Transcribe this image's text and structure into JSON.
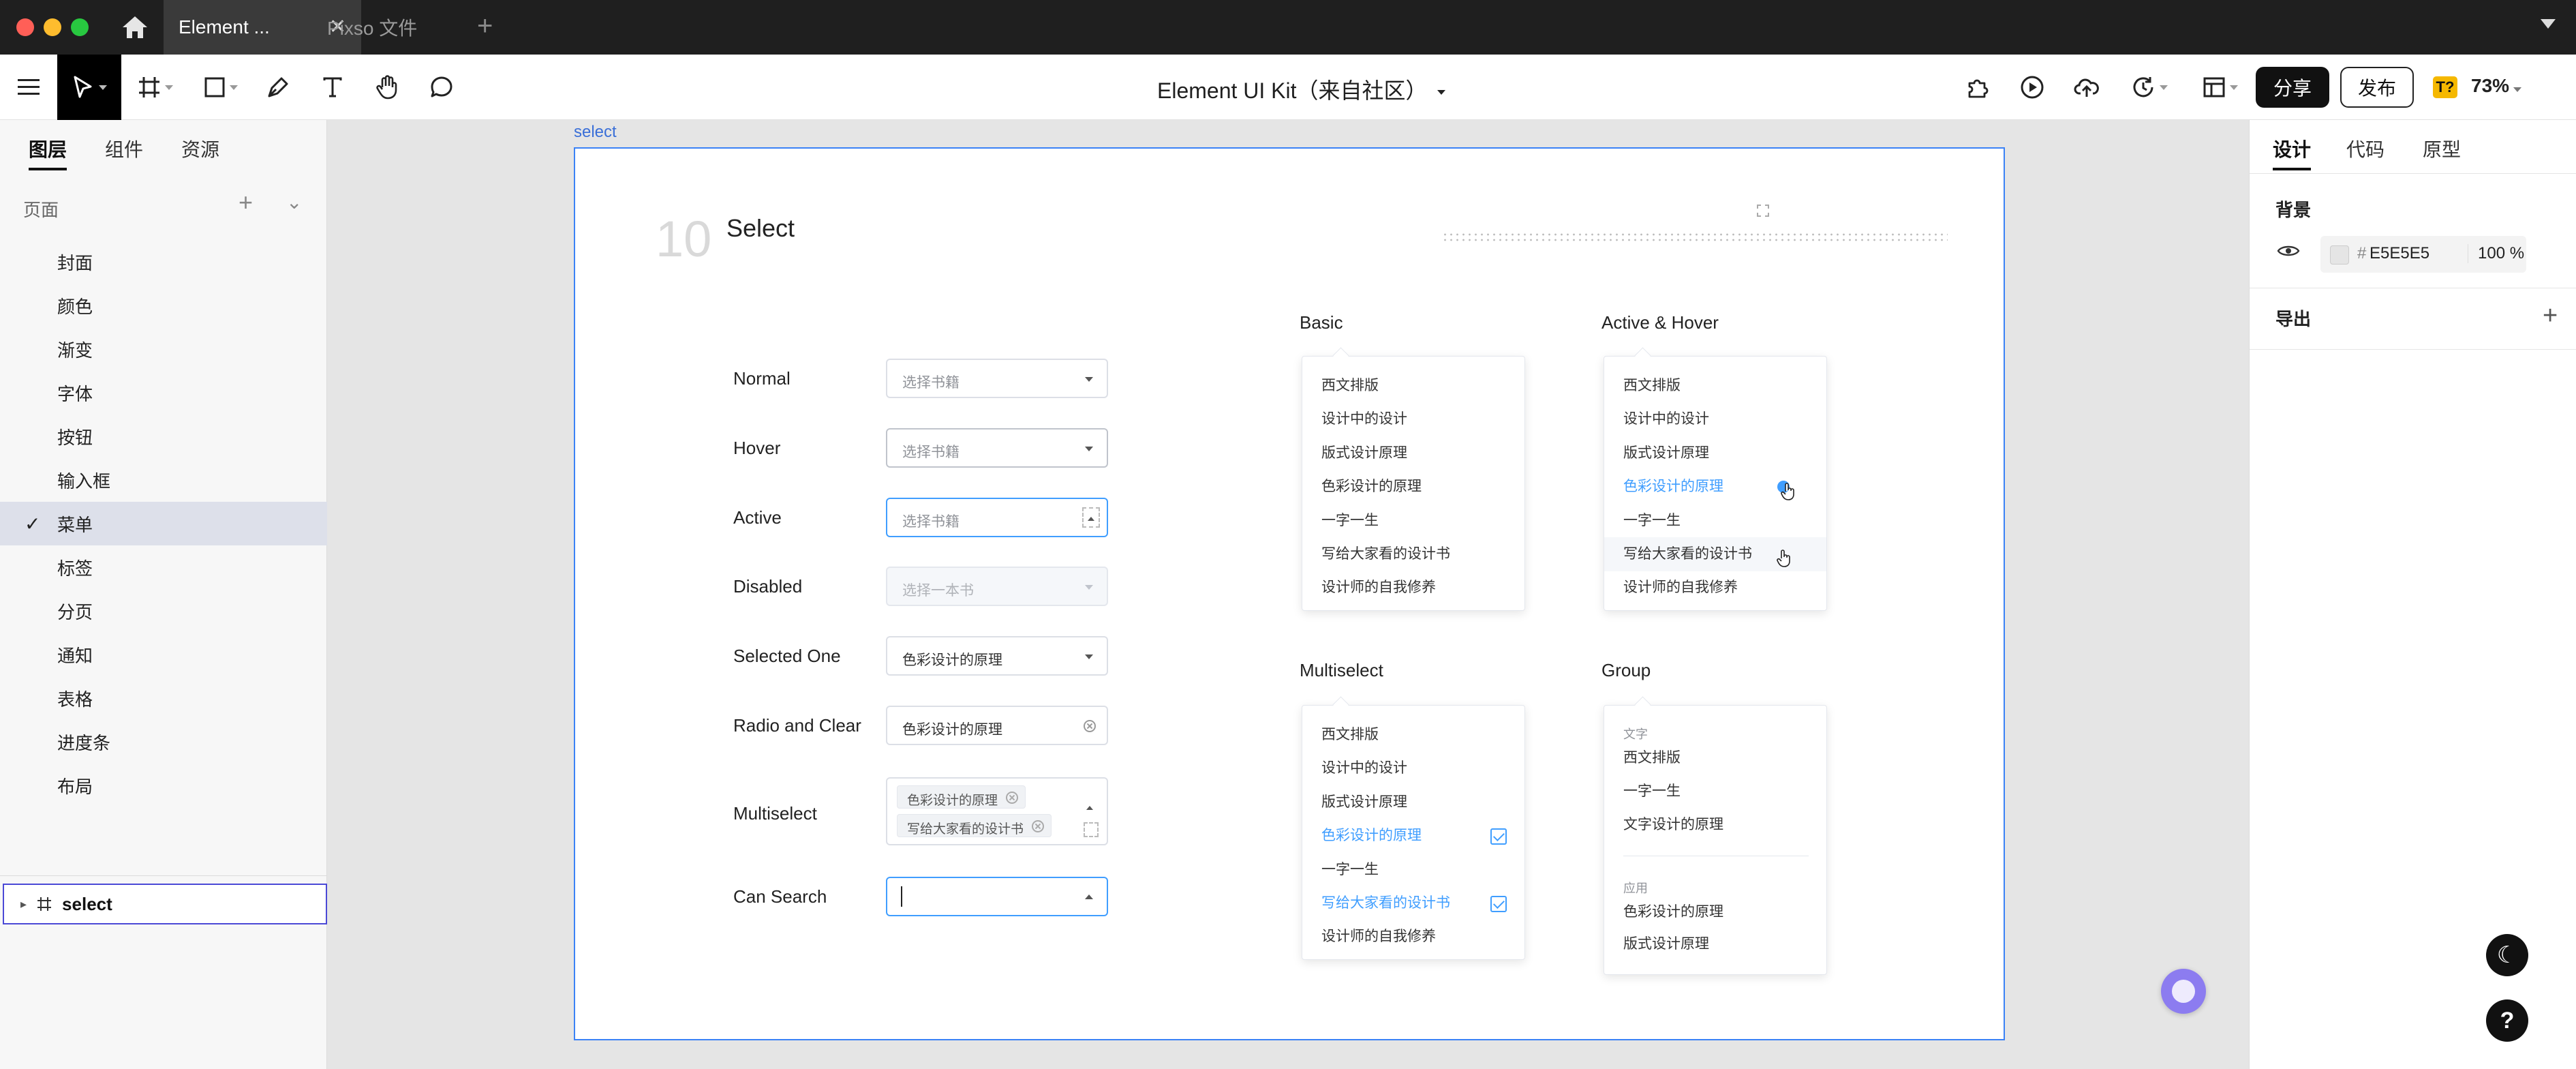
{
  "titlebar": {
    "tabs": [
      {
        "label": "Element ..."
      },
      {
        "label": "Pixso 文件"
      }
    ]
  },
  "toolbar": {
    "doc_title": "Element UI Kit（来自社区）",
    "share_label": "分享",
    "publish_label": "发布",
    "plugin_badge": "T?",
    "zoom": "73%"
  },
  "left_panel": {
    "tabs": [
      "图层",
      "组件",
      "资源"
    ],
    "pages_label": "页面",
    "pages": [
      "封面",
      "颜色",
      "渐变",
      "字体",
      "按钮",
      "输入框",
      "菜单",
      "标签",
      "分页",
      "通知",
      "表格",
      "进度条",
      "布局"
    ],
    "selected_page": "菜单",
    "layer_name": "select"
  },
  "right_panel": {
    "tabs": [
      "设计",
      "代码",
      "原型"
    ],
    "background_label": "背景",
    "bg_hash": "#",
    "bg_hex": "E5E5E5",
    "bg_opacity": "100 %",
    "export_label": "导出"
  },
  "canvas": {
    "frame_label": "select",
    "section_number": "10",
    "section_title": "Select",
    "rows": [
      {
        "label": "Normal",
        "value": "选择书籍"
      },
      {
        "label": "Hover",
        "value": "选择书籍"
      },
      {
        "label": "Active",
        "value": "选择书籍"
      },
      {
        "label": "Disabled",
        "value": "选择一本书"
      },
      {
        "label": "Selected One",
        "value": "色彩设计的原理"
      },
      {
        "label": "Radio and Clear",
        "value": "色彩设计的原理"
      },
      {
        "label": "Multiselect",
        "chips": [
          "色彩设计的原理",
          "写给大家看的设计书"
        ]
      },
      {
        "label": "Can Search",
        "value": ""
      }
    ],
    "basic": {
      "title": "Basic",
      "items": [
        "西文排版",
        "设计中的设计",
        "版式设计原理",
        "色彩设计的原理",
        "一字一生",
        "写给大家看的设计书",
        "设计师的自我修养"
      ]
    },
    "active_hover": {
      "title": "Active & Hover",
      "items": [
        "西文排版",
        "设计中的设计",
        "版式设计原理",
        "色彩设计的原理",
        "一字一生",
        "写给大家看的设计书",
        "设计师的自我修养"
      ]
    },
    "multiselect": {
      "title": "Multiselect",
      "items": [
        "西文排版",
        "设计中的设计",
        "版式设计原理",
        "色彩设计的原理",
        "一字一生",
        "写给大家看的设计书",
        "设计师的自我修养"
      ]
    },
    "group": {
      "title": "Group",
      "group1_label": "文字",
      "group1_items": [
        "西文排版",
        "一字一生",
        "文字设计的原理"
      ],
      "group2_label": "应用",
      "group2_items": [
        "色彩设计的原理",
        "版式设计原理"
      ]
    }
  },
  "colors": {
    "accent": "#409EFF",
    "selection": "#3B82F6",
    "canvas_bg": "#E5E5E5"
  }
}
